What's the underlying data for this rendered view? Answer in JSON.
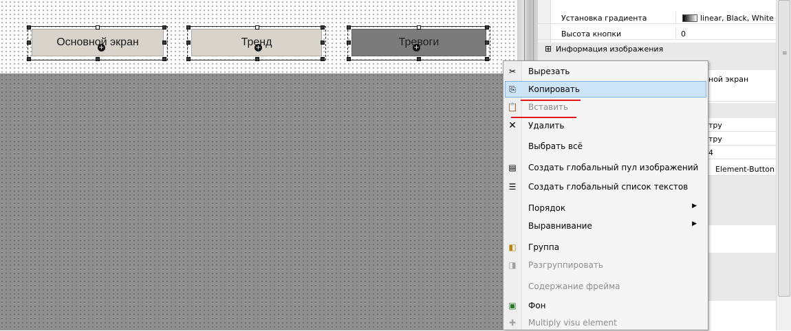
{
  "canvas": {
    "buttons": [
      {
        "label": "Основной экран"
      },
      {
        "label": "Тренд"
      },
      {
        "label": "Тревоги"
      }
    ]
  },
  "properties": {
    "rows": [
      {
        "name": "Установка градиента",
        "value": "linear, Black, White"
      },
      {
        "name": "Высота кнопки",
        "value": "0"
      }
    ],
    "group": {
      "expander": "⊞",
      "name": "Информация изображения"
    },
    "fragments": [
      "ной экран",
      "тру",
      "тру",
      "4",
      "Element-Button"
    ]
  },
  "context_menu": {
    "items": [
      {
        "label": "Вырезать",
        "icon": "scissors-icon",
        "enabled": true
      },
      {
        "label": "Копировать",
        "icon": "copy-icon",
        "enabled": true,
        "highlighted": true
      },
      {
        "label": "Вставить",
        "icon": "paste-icon",
        "enabled": false
      },
      {
        "label": "Удалить",
        "icon": "delete-icon",
        "enabled": true
      },
      {
        "label": "Выбрать всё",
        "enabled": true
      },
      {
        "label": "Создать глобальный пул изображений",
        "icon": "image-pool-icon",
        "enabled": true
      },
      {
        "label": "Создать глобальный список текстов",
        "icon": "text-list-icon",
        "enabled": true
      },
      {
        "label": "Порядок",
        "enabled": true,
        "submenu": true
      },
      {
        "label": "Выравнивание",
        "enabled": true,
        "submenu": true
      },
      {
        "label": "Группа",
        "icon": "group-icon",
        "enabled": true
      },
      {
        "label": "Разгруппировать",
        "icon": "ungroup-icon",
        "enabled": false
      },
      {
        "label": "Содержание фрейма",
        "enabled": false
      },
      {
        "label": "Фон",
        "icon": "background-icon",
        "enabled": true
      },
      {
        "label": "Multiply visu element",
        "icon": "multiply-icon",
        "enabled": false
      }
    ],
    "submenu_arrow": "▶"
  },
  "colors": {
    "highlight": "#cde4f7",
    "annotation_red": "#e4141b",
    "canvas_gray": "#8f8f8f"
  }
}
